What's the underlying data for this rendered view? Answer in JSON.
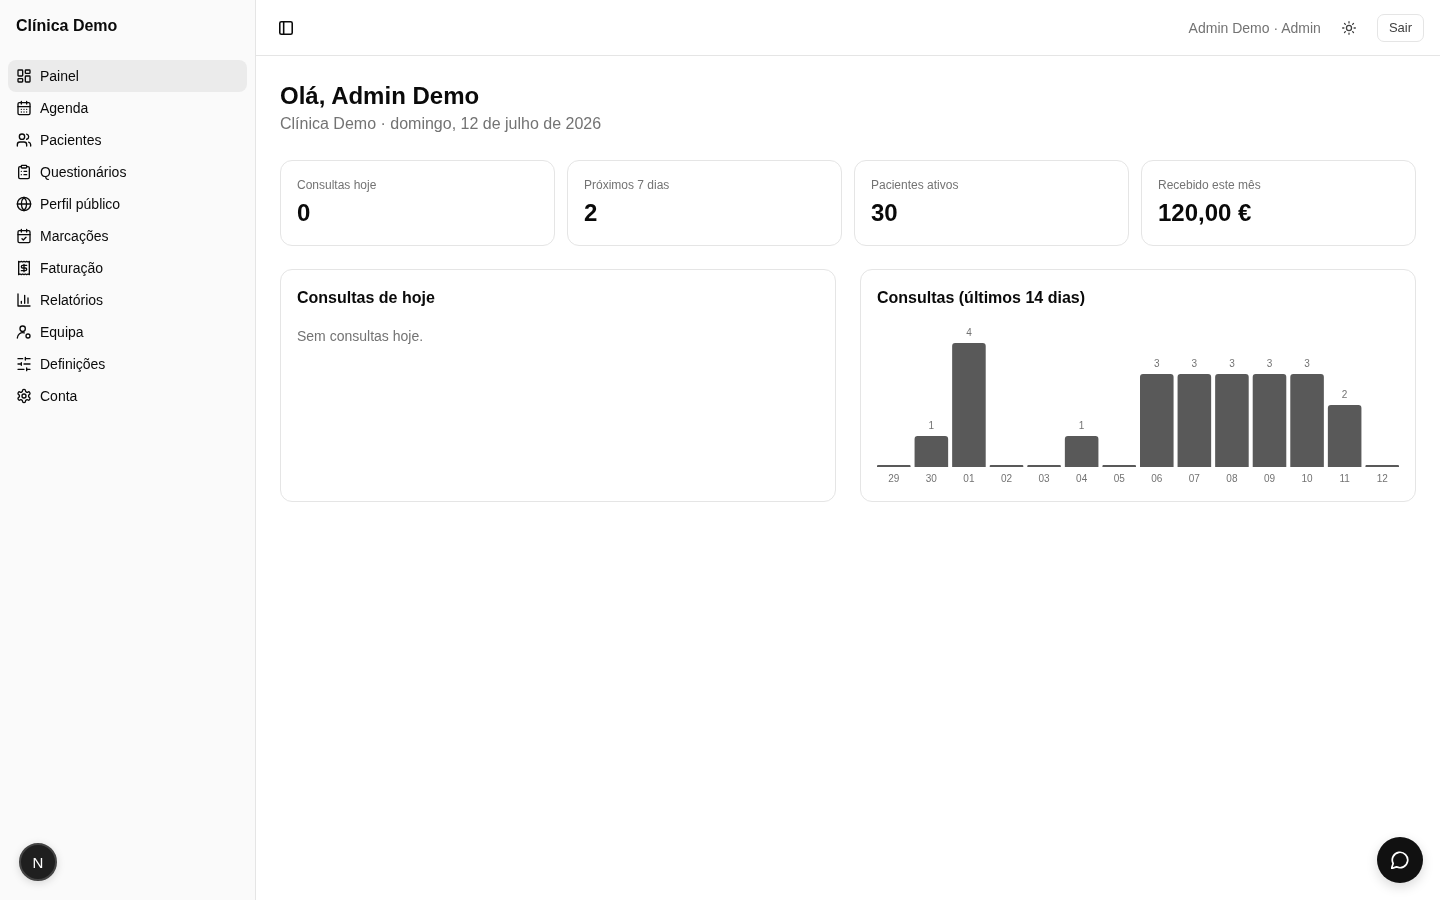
{
  "sidebar": {
    "title": "Clínica Demo",
    "items": [
      {
        "label": "Painel",
        "selected": true
      },
      {
        "label": "Agenda",
        "selected": false
      },
      {
        "label": "Pacientes",
        "selected": false
      },
      {
        "label": "Questionários",
        "selected": false
      },
      {
        "label": "Perfil público",
        "selected": false
      },
      {
        "label": "Marcações",
        "selected": false
      },
      {
        "label": "Faturação",
        "selected": false
      },
      {
        "label": "Relatórios",
        "selected": false
      },
      {
        "label": "Equipa",
        "selected": false
      },
      {
        "label": "Definições",
        "selected": false
      },
      {
        "label": "Conta",
        "selected": false
      }
    ]
  },
  "header": {
    "user": "Admin Demo · Admin",
    "logout": "Sair"
  },
  "greeting": {
    "title": "Olá, Admin Demo",
    "subtitle": "Clínica Demo · domingo, 12 de julho de 2026"
  },
  "stats": [
    {
      "label": "Consultas hoje",
      "value": "0"
    },
    {
      "label": "Próximos 7 dias",
      "value": "2"
    },
    {
      "label": "Pacientes ativos",
      "value": "30"
    },
    {
      "label": "Recebido este mês",
      "value": "120,00 €"
    }
  ],
  "today_panel": {
    "title": "Consultas de hoje",
    "empty_message": "Sem consultas hoje."
  },
  "chart_panel": {
    "chart_data": {
      "type": "bar",
      "title": "Consultas (últimos 14 dias)",
      "categories": [
        "29",
        "30",
        "01",
        "02",
        "03",
        "04",
        "05",
        "06",
        "07",
        "08",
        "09",
        "10",
        "11",
        "12"
      ],
      "values": [
        0,
        1,
        4,
        0,
        0,
        1,
        0,
        3,
        3,
        3,
        3,
        3,
        2,
        0
      ],
      "value_labels": [
        null,
        "1",
        "4",
        null,
        null,
        "1",
        null,
        "3",
        "3",
        "3",
        "3",
        "3",
        "2",
        null
      ]
    }
  },
  "dev_badge": {
    "label": "N"
  }
}
